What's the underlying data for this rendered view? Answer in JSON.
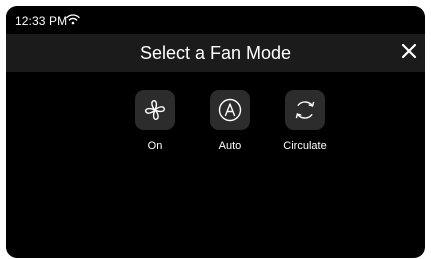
{
  "status_bar": {
    "time": "12:33 PM",
    "wifi_icon": "wifi-icon"
  },
  "header": {
    "title": "Select a Fan Mode",
    "close_icon": "close-icon"
  },
  "fan_modes": [
    {
      "label": "On",
      "icon": "fan-icon"
    },
    {
      "label": "Auto",
      "icon": "auto-a-icon"
    },
    {
      "label": "Circulate",
      "icon": "circulate-icon"
    }
  ],
  "colors": {
    "background": "#000000",
    "header": "#1b1b1b",
    "tile": "#2c2c2c",
    "text": "#ffffff"
  }
}
